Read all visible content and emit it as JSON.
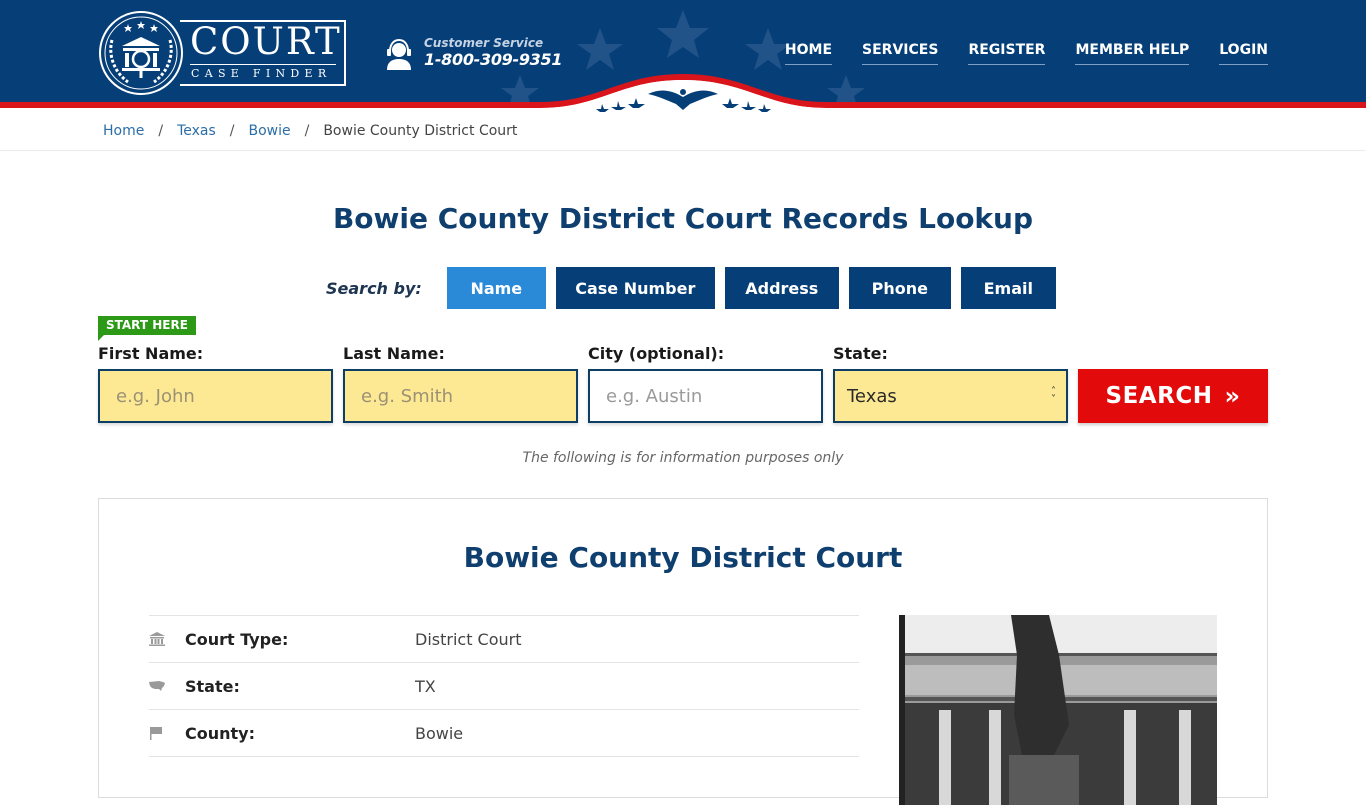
{
  "header": {
    "logo": {
      "title": "COURT",
      "subtitle": "CASE FINDER"
    },
    "customer_service": {
      "label": "Customer Service",
      "phone": "1-800-309-9351"
    },
    "nav": [
      {
        "label": "HOME"
      },
      {
        "label": "SERVICES"
      },
      {
        "label": "REGISTER"
      },
      {
        "label": "MEMBER HELP"
      },
      {
        "label": "LOGIN"
      }
    ],
    "colors": {
      "navy": "#063f78",
      "red": "#e20a0a"
    }
  },
  "breadcrumb": [
    {
      "label": "Home"
    },
    {
      "label": "Texas"
    },
    {
      "label": "Bowie"
    },
    {
      "label": "Bowie County District Court"
    }
  ],
  "main": {
    "title": "Bowie County District Court Records Lookup",
    "search_by_label": "Search by:",
    "tabs": [
      {
        "label": "Name",
        "active": true
      },
      {
        "label": "Case Number"
      },
      {
        "label": "Address"
      },
      {
        "label": "Phone"
      },
      {
        "label": "Email"
      }
    ],
    "start_here": "START HERE",
    "form": {
      "first_name": {
        "label": "First Name:",
        "placeholder": "e.g. John",
        "value": ""
      },
      "last_name": {
        "label": "Last Name:",
        "placeholder": "e.g. Smith",
        "value": ""
      },
      "city": {
        "label": "City (optional):",
        "placeholder": "e.g.  Austin",
        "value": ""
      },
      "state": {
        "label": "State:",
        "selected": "Texas"
      },
      "search_button": "SEARCH",
      "search_chevron": "»"
    },
    "info_note": "The following is for information purposes only"
  },
  "court": {
    "title": "Bowie County District Court",
    "details": [
      {
        "icon": "courthouse-icon",
        "key": "Court Type:",
        "value": "District Court"
      },
      {
        "icon": "usa-map-icon",
        "key": "State:",
        "value": "TX"
      },
      {
        "icon": "flag-icon",
        "key": "County:",
        "value": "Bowie"
      }
    ]
  }
}
